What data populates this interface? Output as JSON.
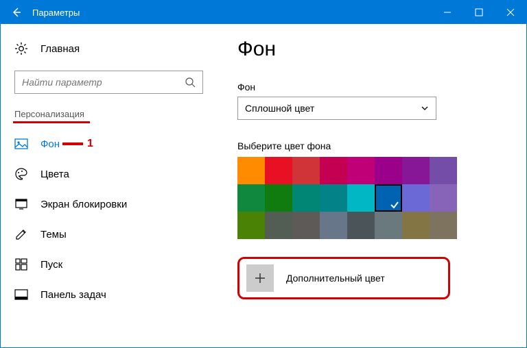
{
  "window": {
    "title": "Параметры"
  },
  "sidebar": {
    "home": "Главная",
    "search_placeholder": "Найти параметр",
    "category": "Персонализация",
    "items": [
      {
        "label": "Фон"
      },
      {
        "label": "Цвета"
      },
      {
        "label": "Экран блокировки"
      },
      {
        "label": "Темы"
      },
      {
        "label": "Пуск"
      },
      {
        "label": "Панель задач"
      }
    ]
  },
  "annotation": {
    "mark1": "1"
  },
  "main": {
    "title": "Фон",
    "bg_label": "Фон",
    "bg_value": "Сплошной цвет",
    "swatch_label": "Выберите цвет фона",
    "rows": [
      [
        "#ff8c00",
        "#e81123",
        "#d13438",
        "#c30052",
        "#bf0077",
        "#9a0089",
        "#881798",
        "#744da9"
      ],
      [
        "#10893e",
        "#107c10",
        "#018574",
        "#038387",
        "#00b7c3",
        "#0063b1",
        "#6b69d6",
        "#8764b8"
      ],
      [
        "#498205",
        "#525e54",
        "#5d5a58",
        "#68768a",
        "#4a5459",
        "#69797e",
        "#847545",
        "#7e735f"
      ]
    ],
    "selected_index": [
      1,
      5
    ],
    "custom_label": "Дополнительный цвет"
  }
}
